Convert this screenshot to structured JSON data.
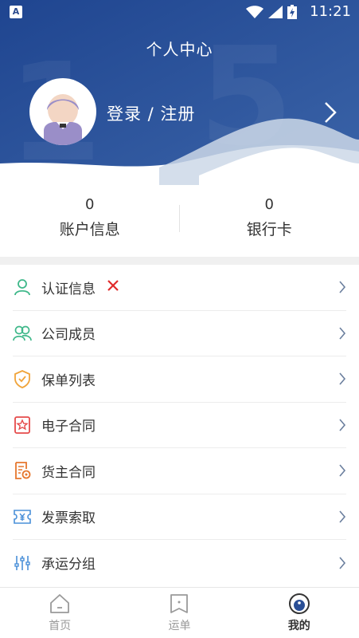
{
  "status_bar": {
    "time": "11:21",
    "app_indicator": "A"
  },
  "header": {
    "title": "个人中心",
    "login_label": "登录 / 注册",
    "colors": {
      "primary": "#2a4f96",
      "light": "#cfdaea"
    }
  },
  "stats": [
    {
      "value": "0",
      "label": "账户信息"
    },
    {
      "value": "0",
      "label": "银行卡"
    }
  ],
  "menu": [
    {
      "label": "认证信息",
      "icon": "user-icon",
      "color": "#3fb88a",
      "badge": "x-mark"
    },
    {
      "label": "公司成员",
      "icon": "users-icon",
      "color": "#3fb88a"
    },
    {
      "label": "保单列表",
      "icon": "shield-check-icon",
      "color": "#f0a43a"
    },
    {
      "label": "电子合同",
      "icon": "contract-star-icon",
      "color": "#e54b4b"
    },
    {
      "label": "货主合同",
      "icon": "document-seal-icon",
      "color": "#e6772e"
    },
    {
      "label": "发票索取",
      "icon": "invoice-icon",
      "color": "#4a90d9"
    },
    {
      "label": "承运分组",
      "icon": "sliders-icon",
      "color": "#4a90d9"
    }
  ],
  "tabbar": [
    {
      "label": "首页",
      "icon": "home-icon",
      "active": false
    },
    {
      "label": "运单",
      "icon": "waybill-icon",
      "active": false
    },
    {
      "label": "我的",
      "icon": "profile-icon",
      "active": true
    }
  ]
}
